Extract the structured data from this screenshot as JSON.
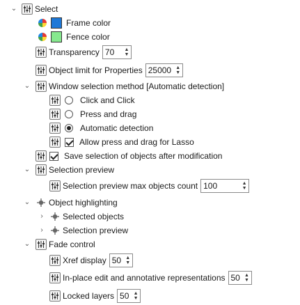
{
  "tree": {
    "select": {
      "label": "Select",
      "frame_color": {
        "label": "Frame color",
        "swatch": "#1e78d7"
      },
      "fence_color": {
        "label": "Fence color",
        "swatch": "#86e88e"
      },
      "transparency": {
        "label": "Transparency",
        "value": "70"
      },
      "object_limit": {
        "label": "Object limit for Properties",
        "value": "25000"
      },
      "window_selection": {
        "label": "Window selection method [Automatic detection]",
        "options": [
          {
            "label": "Click and Click",
            "selected": false
          },
          {
            "label": "Press and drag",
            "selected": false
          },
          {
            "label": "Automatic detection",
            "selected": true
          }
        ],
        "lasso": {
          "label": "Allow press and drag for Lasso",
          "checked": true
        }
      },
      "save_selection": {
        "label": "Save selection of objects after modification",
        "checked": true
      }
    },
    "selection_preview": {
      "label": "Selection preview",
      "max_objects": {
        "label": "Selection preview max objects count",
        "value": "100"
      }
    },
    "object_highlighting": {
      "label": "Object highlighting",
      "children": [
        {
          "label": "Selected objects"
        },
        {
          "label": "Selection preview"
        }
      ]
    },
    "fade_control": {
      "label": "Fade control",
      "xref": {
        "label": "Xref display",
        "value": "50"
      },
      "inplace": {
        "label": "In-place edit and annotative representations",
        "value": "50"
      },
      "locked": {
        "label": "Locked layers",
        "value": "50"
      }
    }
  }
}
